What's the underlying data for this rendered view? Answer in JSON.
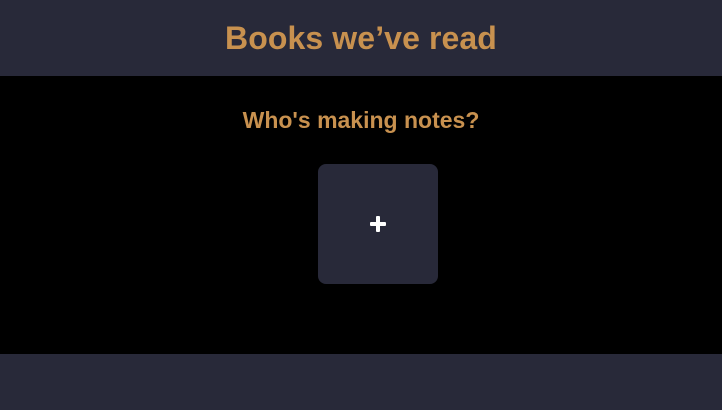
{
  "header": {
    "title": "Books we’ve read"
  },
  "main": {
    "heading": "Who's making notes?",
    "add_profile": {
      "label": "Add profile",
      "icon": "plus-icon"
    }
  },
  "footer": {},
  "colors": {
    "header_background": "#282939",
    "page_background": "#000000",
    "accent_text": "#c8914f",
    "tile_background": "#282939",
    "icon_foreground": "#ffffff"
  }
}
